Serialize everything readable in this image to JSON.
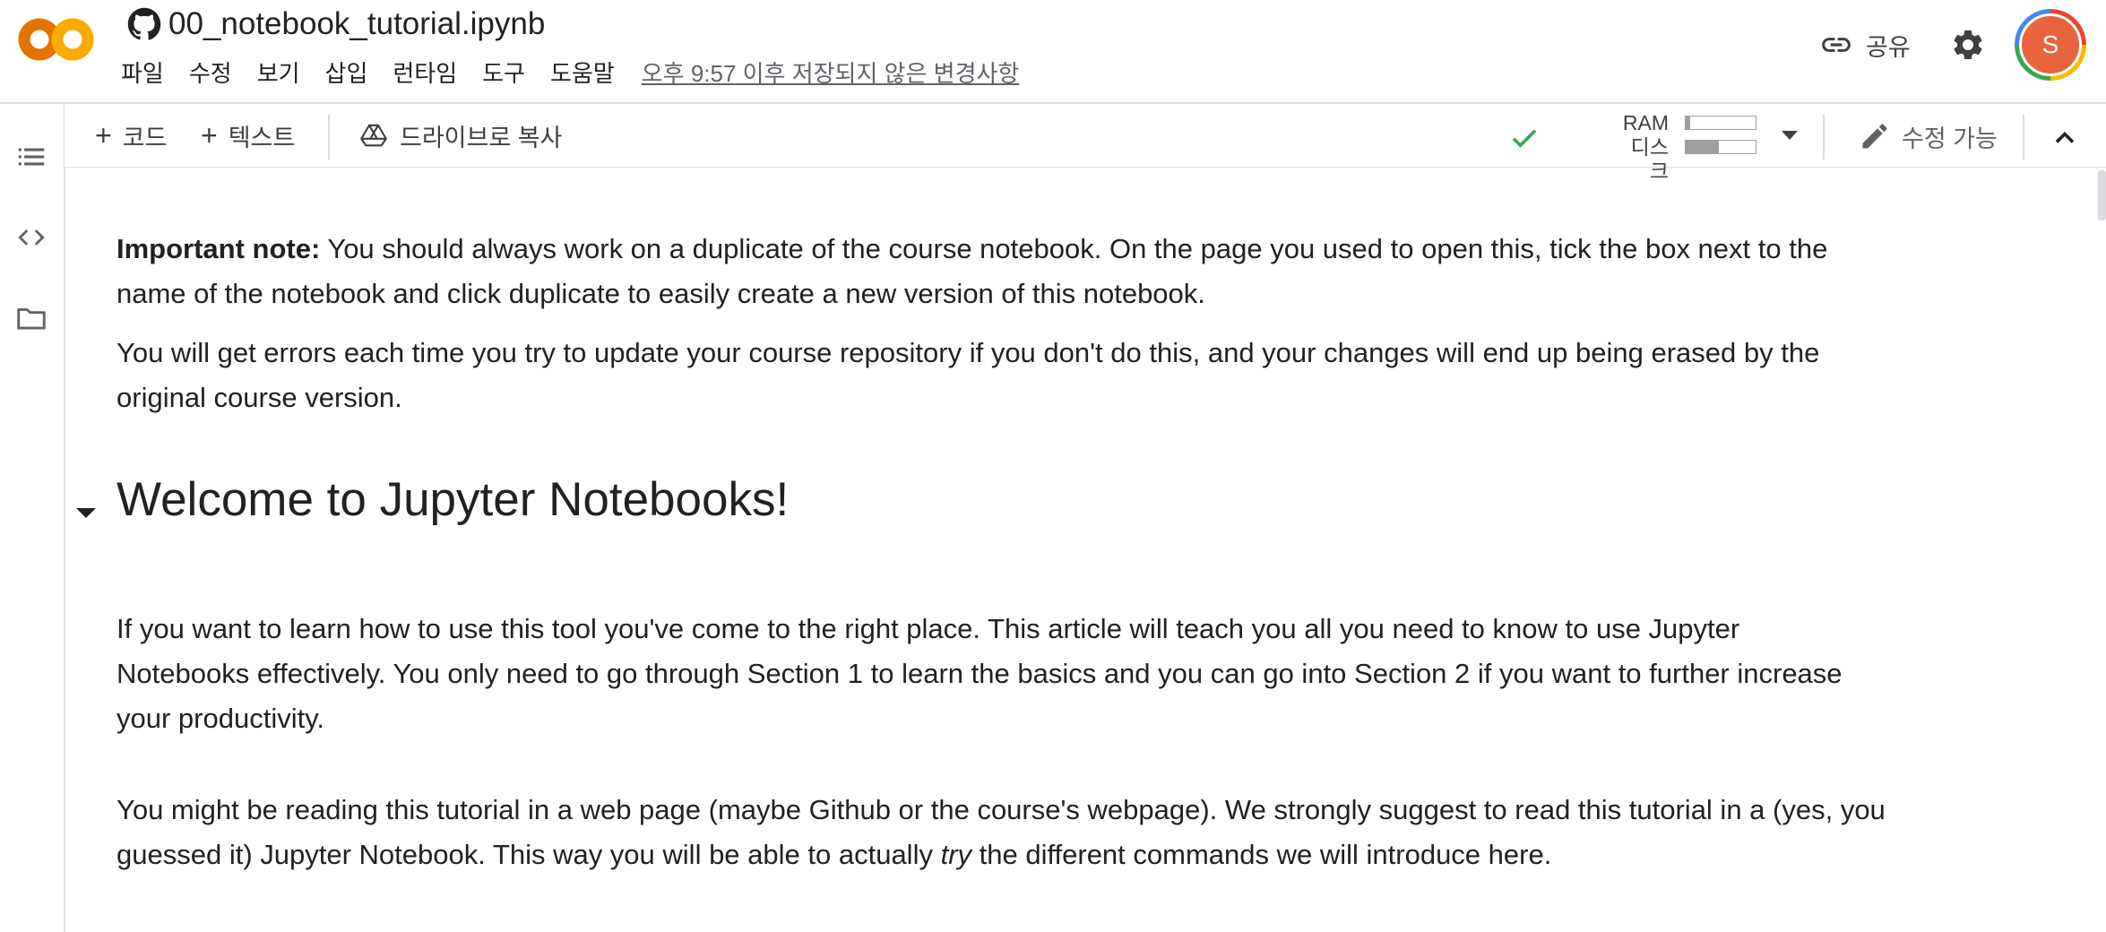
{
  "header": {
    "title": "00_notebook_tutorial.ipynb",
    "menu": [
      "파일",
      "수정",
      "보기",
      "삽입",
      "런타임",
      "도구",
      "도움말"
    ],
    "save_status": "오후 9:57 이후 저장되지 않은 변경사항",
    "share_label": "공유",
    "avatar_initial": "S"
  },
  "toolbar": {
    "add_code": "코드",
    "add_text": "텍스트",
    "copy_to_drive": "드라이브로 복사",
    "resources": {
      "ram_label": "RAM",
      "disk_label": "디스크"
    },
    "edit_label": "수정 가능"
  },
  "content": {
    "note_bold": "Important note:",
    "note_line1_rest": " You should always work on a duplicate of the course notebook. On the page you used to open this, tick the box next to the",
    "note_line2": "name of the notebook and click duplicate to easily create a new version of this notebook.",
    "warn_line1": "You will get errors each time you try to update your course repository if you don't do this, and your changes will end up being erased by the",
    "warn_line2": "original course version.",
    "heading": "Welcome to Jupyter Notebooks!",
    "intro_line1": "If you want to learn how to use this tool you've come to the right place. This article will teach you all you need to know to use Jupyter",
    "intro_line2": "Notebooks effectively. You only need to go through Section 1 to learn the basics and you can go into Section 2 if you want to further increase",
    "intro_line3": "your productivity.",
    "reading_line1": "You might be reading this tutorial in a web page (maybe Github or the course's webpage). We strongly suggest to read this tutorial in a (yes, you",
    "reading_line2_pre": "guessed it) Jupyter Notebook. This way you will be able to actually ",
    "reading_line2_em": "try",
    "reading_line2_post": " the different commands we will introduce here."
  },
  "colors": {
    "logo_orange": "#f9ab00",
    "logo_orange_dark": "#e37400",
    "check_green": "#34a853",
    "avatar_bg": "#e8643c",
    "divider": "#dadce0"
  },
  "icons": [
    "colab-logo",
    "github-icon",
    "link-icon",
    "gear-icon",
    "check-icon",
    "dropdown-icon",
    "pencil-icon",
    "chevron-up-icon",
    "toc-icon",
    "code-icon",
    "folder-icon",
    "drive-icon"
  ]
}
